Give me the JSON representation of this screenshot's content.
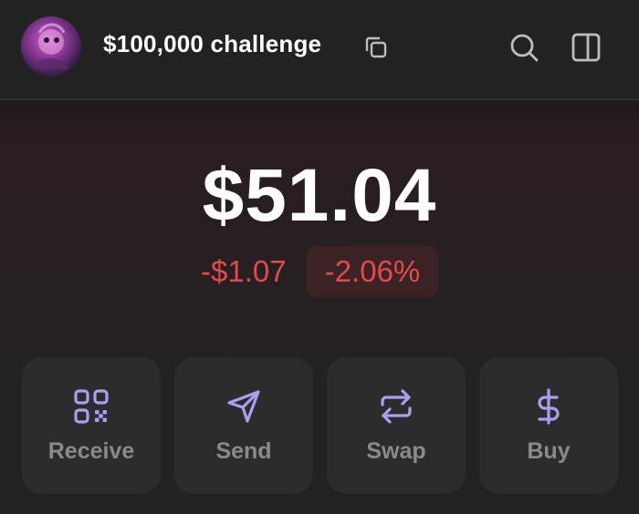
{
  "header": {
    "account_name": "$100,000 challenge",
    "avatar_icon": "avatar-image",
    "copy_icon": "copy-icon",
    "search_icon": "search-icon",
    "panel_icon": "sidebar-panel-icon"
  },
  "balance": {
    "amount": "$51.04",
    "change_abs": "-$1.07",
    "change_pct": "-2.06%"
  },
  "actions": [
    {
      "label": "Receive",
      "icon": "qr-code-icon"
    },
    {
      "label": "Send",
      "icon": "paper-plane-icon"
    },
    {
      "label": "Swap",
      "icon": "swap-arrows-icon"
    },
    {
      "label": "Buy",
      "icon": "dollar-sign-icon"
    }
  ],
  "colors": {
    "background": "#222222",
    "card": "#2c2c2c",
    "accent": "#ab9ff2",
    "negative": "#e5484d",
    "negative_bg": "#3a2225",
    "muted_text": "#8a8a8a"
  }
}
